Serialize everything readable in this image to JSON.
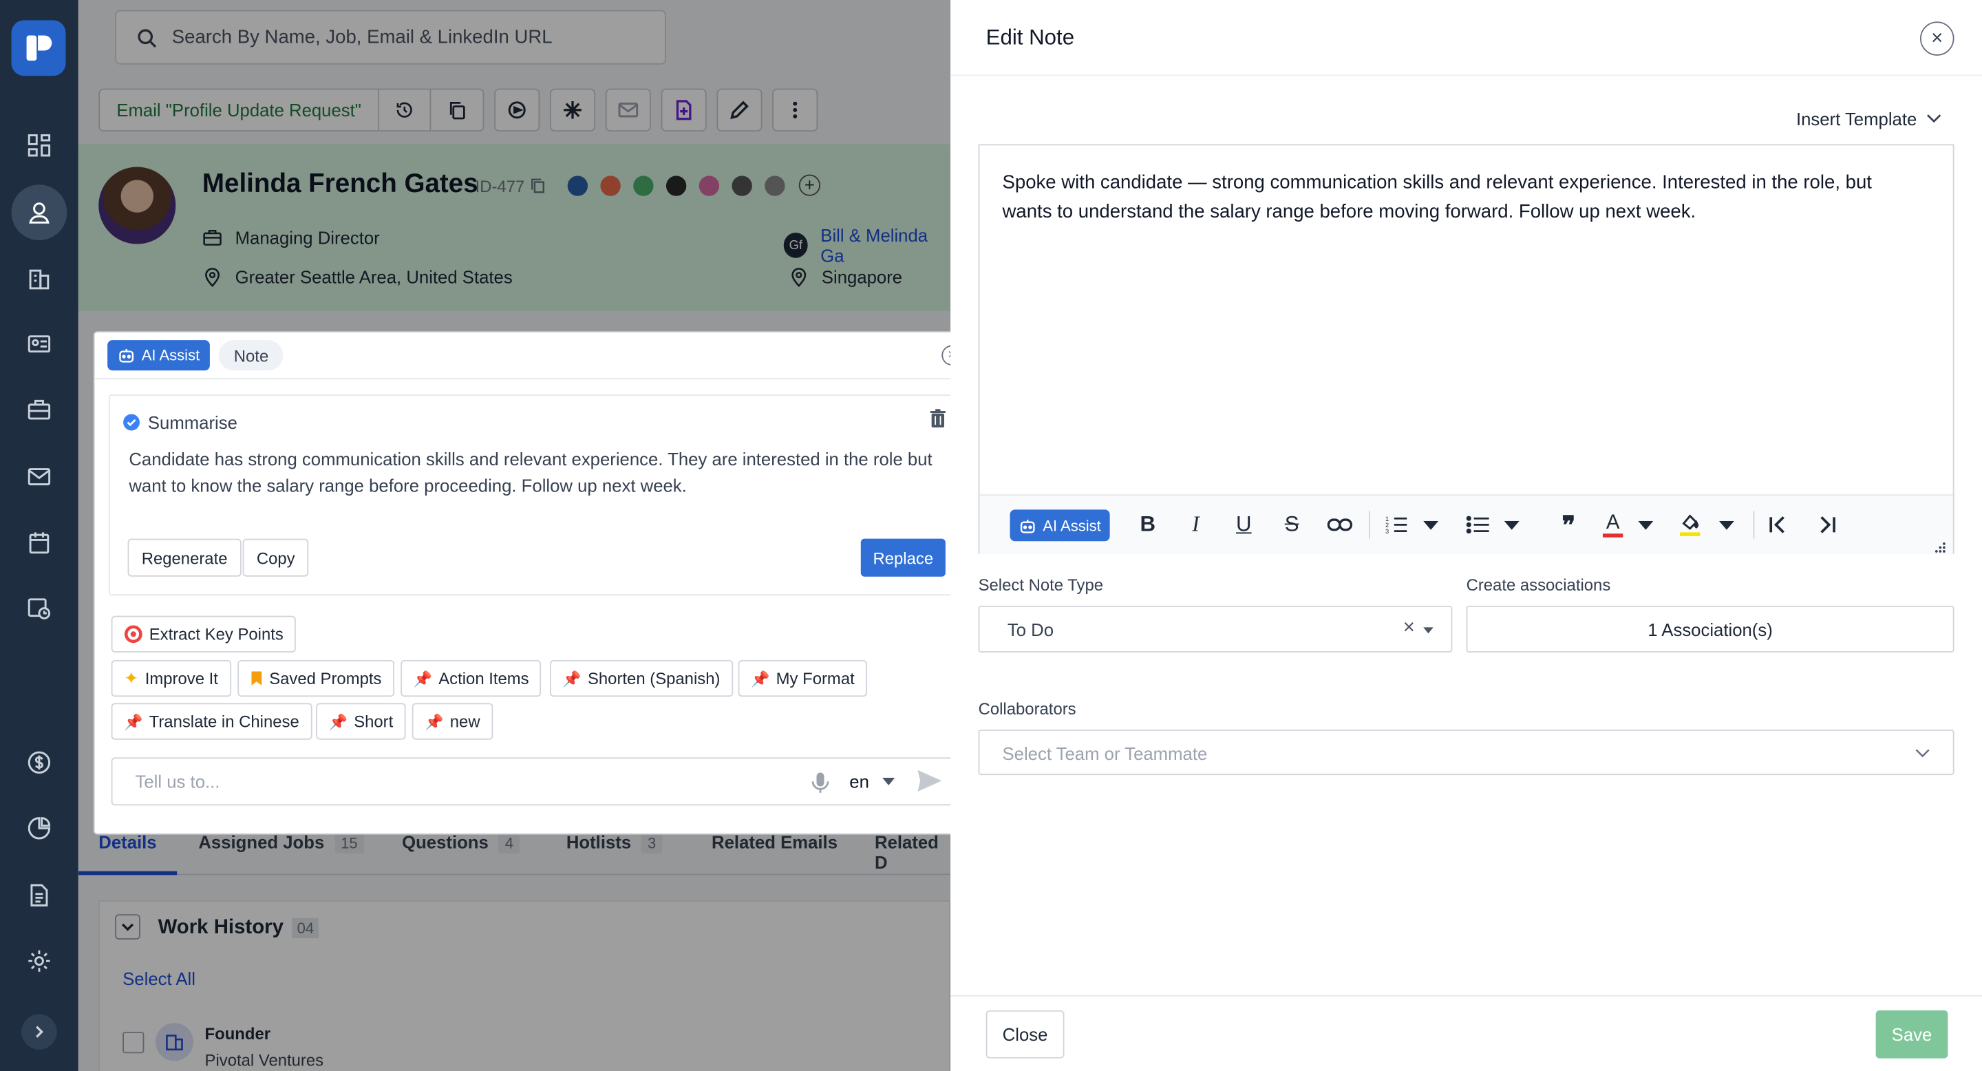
{
  "search": {
    "placeholder": "Search By Name, Job, Email & LinkedIn URL"
  },
  "toolbar": {
    "email_label": "Email \"Profile Update Request\""
  },
  "profile": {
    "name": "Melinda French Gates",
    "id": "ID-477",
    "title": "Managing Director",
    "location": "Greater Seattle Area, United States",
    "company": "Bill & Melinda Ga",
    "company_location": "Singapore"
  },
  "tabs": [
    {
      "label": "Details"
    },
    {
      "label": "Assigned Jobs",
      "count": "15"
    },
    {
      "label": "Questions",
      "count": "4"
    },
    {
      "label": "Hotlists",
      "count": "3"
    },
    {
      "label": "Related Emails"
    },
    {
      "label": "Related D"
    }
  ],
  "work_history": {
    "title": "Work History",
    "count": "04",
    "select_all": "Select All",
    "items": [
      {
        "role": "Founder",
        "org": "Pivotal Ventures"
      }
    ]
  },
  "ai_assist": {
    "tab_ai": "AI Assist",
    "tab_note": "Note",
    "summary_title": "Summarise",
    "summary_text": "Candidate has strong communication skills and relevant experience. They are interested in the role but want to know the salary range before proceeding. Follow up next week.",
    "regenerate": "Regenerate",
    "copy": "Copy",
    "replace": "Replace",
    "prompts": [
      "Extract Key Points",
      "Improve It",
      "Saved Prompts",
      "Action Items",
      "Shorten (Spanish)",
      "My Format",
      "Translate in Chinese",
      "Short",
      "new"
    ],
    "input_placeholder": "Tell us to...",
    "language": "en"
  },
  "edit_note": {
    "title": "Edit Note",
    "insert_template": "Insert Template",
    "body": "Spoke with candidate — strong communication skills and relevant experience. Interested in the role, but wants to understand the salary range before moving forward. Follow up next week.",
    "ai_button": "AI Assist",
    "note_type_label": "Select Note Type",
    "note_type_value": "To Do",
    "associations_label": "Create associations",
    "associations_value": "1 Association(s)",
    "collaborators_label": "Collaborators",
    "collaborators_placeholder": "Select Team or Teammate",
    "close_label": "Close",
    "save_label": "Save"
  },
  "colors": {
    "primary": "#2f6fd6",
    "sidebar": "#1e2d3f",
    "save": "#7fc79a",
    "profile_bg": "#d6f1de"
  }
}
